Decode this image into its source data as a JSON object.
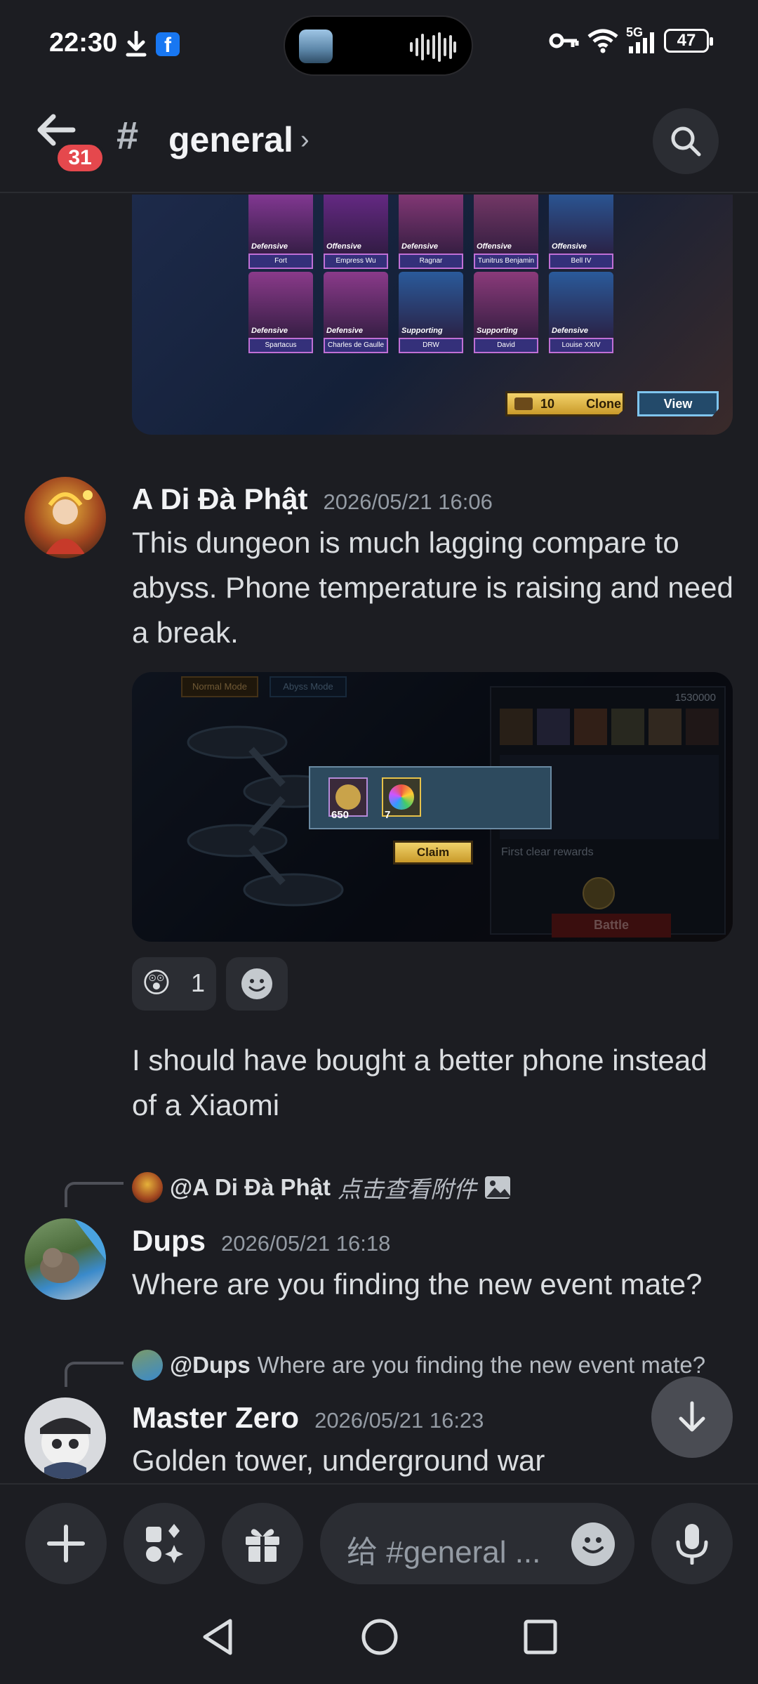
{
  "status_bar": {
    "time": "22:30",
    "network": "5G",
    "battery": "47"
  },
  "header": {
    "unread_count": "31",
    "channel_name": "general"
  },
  "messages": [
    {
      "author": "A Di Đà Phật",
      "timestamp": "2026/05/21 16:06",
      "text": "This dungeon is much lagging compare to abyss. Phone temperature is raising and need a break.",
      "reaction": {
        "emoji": "😲",
        "count": "1"
      },
      "followup": "I should have bought a better phone instead of a Xiaomi"
    },
    {
      "reply_to_name": "@A Di Đà Phật",
      "reply_to_text": "点击查看附件",
      "author": "Dups",
      "timestamp": "2026/05/21 16:18",
      "text": "Where are you finding the new event mate?"
    },
    {
      "reply_to_name": "@Dups",
      "reply_to_text": "Where are you finding the new event mate?",
      "author": "Master Zero",
      "timestamp": "2026/05/21 16:23",
      "text": "Golden tower, underground war"
    }
  ],
  "card1": {
    "heroes_row1": [
      {
        "type": "Defensive",
        "name": "Fort"
      },
      {
        "type": "Offensive",
        "name": "Empress Wu"
      },
      {
        "type": "Defensive",
        "name": "Ragnar"
      },
      {
        "type": "Offensive",
        "name": "Tunitrus Benjamin"
      },
      {
        "type": "Offensive",
        "name": "Bell IV"
      }
    ],
    "heroes_row2": [
      {
        "type": "Defensive",
        "name": "Spartacus"
      },
      {
        "type": "Defensive",
        "name": "Charles de Gaulle"
      },
      {
        "type": "Supporting",
        "name": "DRW"
      },
      {
        "type": "Supporting",
        "name": "David"
      },
      {
        "type": "Defensive",
        "name": "Louise XXIV"
      }
    ],
    "clone_count": "10",
    "clone_label": "Clone",
    "view_label": "View"
  },
  "card2": {
    "tab_normal": "Normal Mode",
    "tab_abyss": "Abyss Mode",
    "power": "1530000",
    "reward1": "650",
    "reward2": "7",
    "claim_label": "Claim",
    "first_clear": "First clear rewards",
    "battle_label": "Battle"
  },
  "composer": {
    "placeholder": "给 #general ..."
  },
  "colors": {
    "background": "#1c1d22",
    "surface": "#2b2d33",
    "badge": "#e5484d",
    "text": "#dbdee1",
    "muted": "#949ba4"
  }
}
